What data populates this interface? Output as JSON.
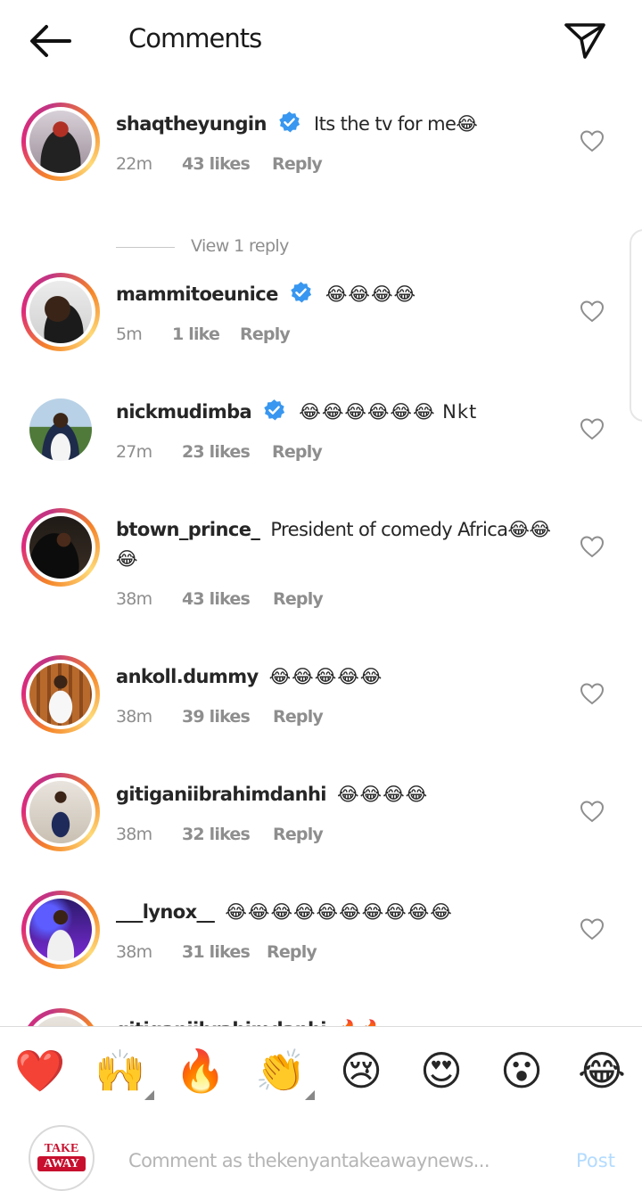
{
  "header": {
    "title": "Comments",
    "back_icon": "arrow-left-icon",
    "share_icon": "paper-plane-icon"
  },
  "comments": [
    {
      "username": "shaqtheyungin",
      "verified": true,
      "text": "Its the tv for me😂",
      "time": "22m",
      "likes": "43 likes",
      "reply": "Reply",
      "view_replies": "View 1 reply"
    },
    {
      "username": "mammitoeunice",
      "verified": true,
      "text": "😂😂😂😂",
      "time": "5m",
      "likes": "1 like",
      "reply": "Reply"
    },
    {
      "username": "nickmudimba",
      "verified": true,
      "text": "😂😂😂😂😂😂 Nkt",
      "time": "27m",
      "likes": "23 likes",
      "reply": "Reply"
    },
    {
      "username": "btown_prince_",
      "verified": false,
      "text": "President of comedy Africa😂😂😂",
      "time": "38m",
      "likes": "43 likes",
      "reply": "Reply"
    },
    {
      "username": "ankoll.dummy",
      "verified": false,
      "text": "😂😂😂😂😂",
      "time": "38m",
      "likes": "39 likes",
      "reply": "Reply"
    },
    {
      "username": "gitiganiibrahimdanhi",
      "verified": false,
      "text": "😂😂😂😂",
      "time": "38m",
      "likes": "32 likes",
      "reply": "Reply"
    },
    {
      "username": "___lynox__",
      "verified": false,
      "text": "😂😂😂😂😂😂😂😂😂😂",
      "time": "38m",
      "likes": "31 likes",
      "reply": "Reply"
    },
    {
      "username": "gitiganiibrahimdanhi",
      "verified": false,
      "text": "🔥🔥",
      "time": "",
      "likes": "",
      "reply": ""
    }
  ],
  "quick_reactions": [
    "❤️",
    "🙌",
    "🔥",
    "👏",
    "😢",
    "😍",
    "😮",
    "😂"
  ],
  "composer": {
    "placeholder": "Comment as thekenyantakeawaynews...",
    "post_label": "Post",
    "avatar_logo_line1": "TAKE",
    "avatar_logo_line2": "AWAY"
  },
  "colors": {
    "verified": "#3897f0",
    "post_disabled": "#b3dbff",
    "meta": "#8e8e8e"
  }
}
